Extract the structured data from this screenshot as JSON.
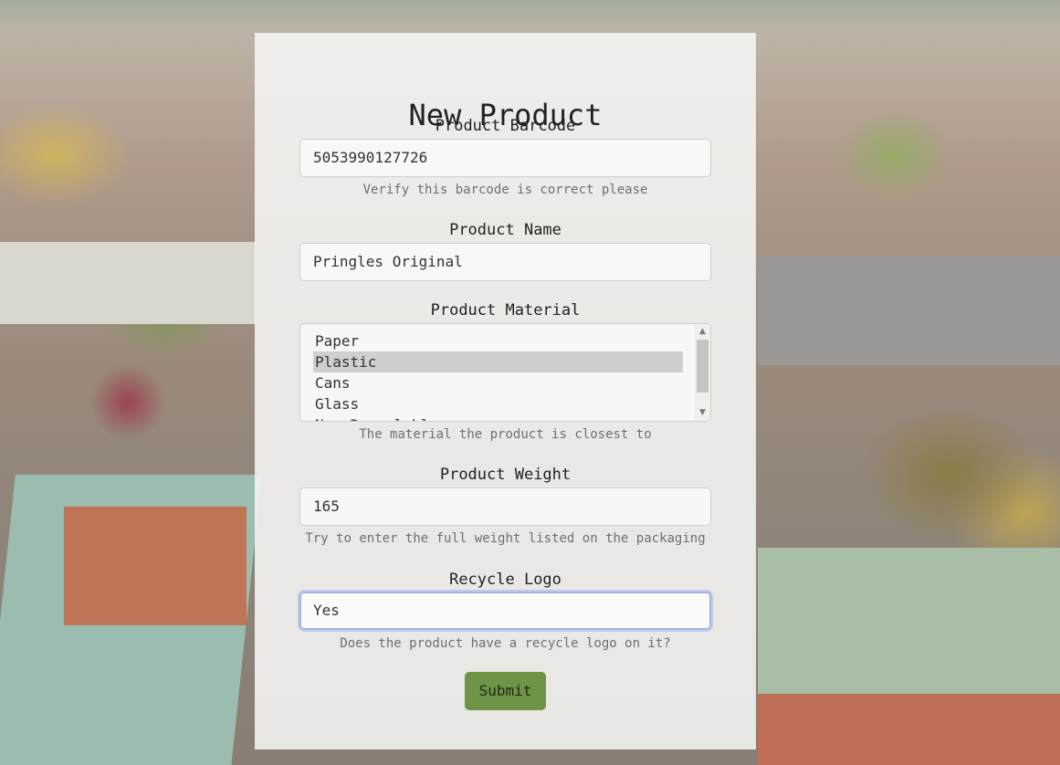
{
  "form": {
    "title": "New Product",
    "barcode": {
      "label": "Product Barcode",
      "value": "5053990127726",
      "hint": "Verify this barcode is correct please"
    },
    "name": {
      "label": "Product Name",
      "value": "Pringles Original"
    },
    "material": {
      "label": "Product Material",
      "options": [
        "Paper",
        "Plastic",
        "Cans",
        "Glass",
        "Non-Recyclable"
      ],
      "selected": "Plastic",
      "hint": "The material the product is closest to"
    },
    "weight": {
      "label": "Product Weight",
      "value": "165",
      "hint": "Try to enter the full weight listed on the packaging"
    },
    "recycle": {
      "label": "Recycle Logo",
      "value": "Yes",
      "hint": "Does the product have a recycle logo on it?"
    },
    "submit_label": "Submit"
  },
  "colors": {
    "submit_bg": "#6f9448",
    "focus_ring": "#9fb6e8",
    "selected_option_bg": "#cfcfcb"
  }
}
